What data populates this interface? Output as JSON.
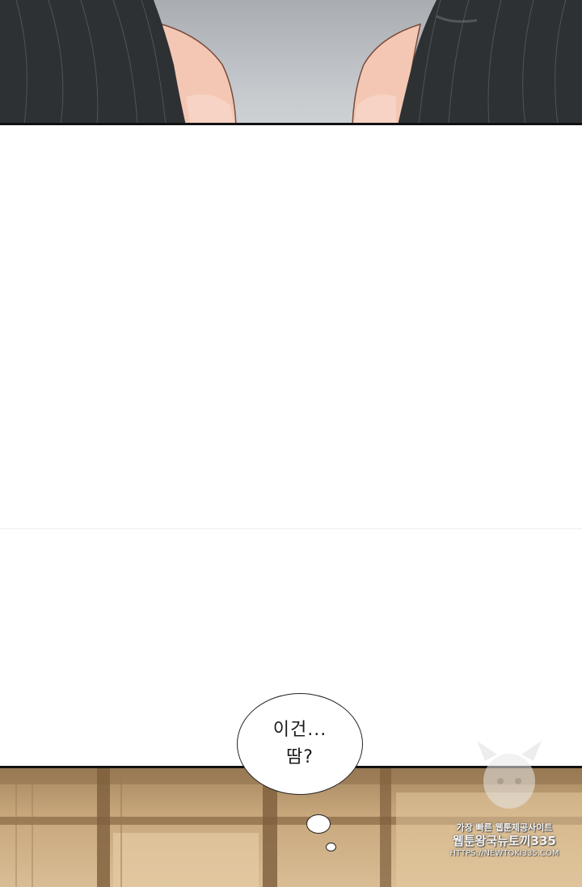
{
  "bubble": {
    "line1": "이건...",
    "line2": "땀?"
  },
  "watermark": {
    "line1": "가장 빠른 웹툰제공사이트",
    "line2": "웹툰왕국뉴토끼335",
    "line3": "HTTPS://NEWTOKI335.COM"
  },
  "colors": {
    "hair": "#2e3133",
    "skin": "#f3c7b4",
    "sky": "#b9bdc1",
    "wood": "#c8a77c",
    "border": "#111111"
  }
}
